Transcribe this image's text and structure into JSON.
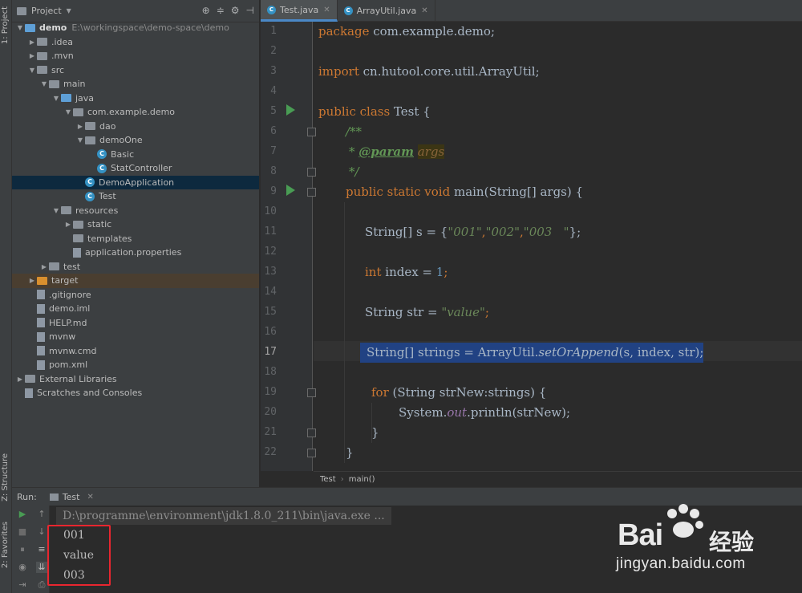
{
  "leftstrip": {
    "project_label": "1: Project",
    "structure_label": "Z: Structure",
    "favorites_label": "2: Favorites"
  },
  "project": {
    "header": "Project",
    "tree": [
      {
        "depth": 0,
        "arrow": "▼",
        "icon": "folder-blue",
        "label": "demo",
        "extra": "E:\\workingspace\\demo-space\\demo",
        "bold": true
      },
      {
        "depth": 1,
        "arrow": "▶",
        "icon": "folder",
        "label": ".idea"
      },
      {
        "depth": 1,
        "arrow": "▶",
        "icon": "folder",
        "label": ".mvn"
      },
      {
        "depth": 1,
        "arrow": "▼",
        "icon": "folder",
        "label": "src"
      },
      {
        "depth": 2,
        "arrow": "▼",
        "icon": "folder",
        "label": "main"
      },
      {
        "depth": 3,
        "arrow": "▼",
        "icon": "folder-blue",
        "label": "java"
      },
      {
        "depth": 4,
        "arrow": "▼",
        "icon": "folder",
        "label": "com.example.demo"
      },
      {
        "depth": 5,
        "arrow": "▶",
        "icon": "folder",
        "label": "dao"
      },
      {
        "depth": 5,
        "arrow": "▼",
        "icon": "folder",
        "label": "demoOne"
      },
      {
        "depth": 6,
        "arrow": "",
        "icon": "class",
        "label": "Basic"
      },
      {
        "depth": 6,
        "arrow": "",
        "icon": "class",
        "label": "StatController"
      },
      {
        "depth": 5,
        "arrow": "",
        "icon": "class",
        "label": "DemoApplication",
        "selected": true
      },
      {
        "depth": 5,
        "arrow": "",
        "icon": "class",
        "label": "Test"
      },
      {
        "depth": 3,
        "arrow": "▼",
        "icon": "folder",
        "label": "resources"
      },
      {
        "depth": 4,
        "arrow": "▶",
        "icon": "folder",
        "label": "static"
      },
      {
        "depth": 4,
        "arrow": "",
        "icon": "folder",
        "label": "templates"
      },
      {
        "depth": 4,
        "arrow": "",
        "icon": "file",
        "label": "application.properties"
      },
      {
        "depth": 2,
        "arrow": "▶",
        "icon": "folder",
        "label": "test"
      },
      {
        "depth": 1,
        "arrow": "▶",
        "icon": "folder-orange",
        "label": "target",
        "target": true
      },
      {
        "depth": 1,
        "arrow": "",
        "icon": "file",
        "label": ".gitignore"
      },
      {
        "depth": 1,
        "arrow": "",
        "icon": "file",
        "label": "demo.iml"
      },
      {
        "depth": 1,
        "arrow": "",
        "icon": "file",
        "label": "HELP.md"
      },
      {
        "depth": 1,
        "arrow": "",
        "icon": "file",
        "label": "mvnw"
      },
      {
        "depth": 1,
        "arrow": "",
        "icon": "file",
        "label": "mvnw.cmd"
      },
      {
        "depth": 1,
        "arrow": "",
        "icon": "file",
        "label": "pom.xml"
      },
      {
        "depth": 0,
        "arrow": "▶",
        "icon": "library",
        "label": "External Libraries"
      },
      {
        "depth": 0,
        "arrow": "",
        "icon": "scratch",
        "label": "Scratches and Consoles"
      }
    ]
  },
  "tabs": [
    {
      "label": "Test.java",
      "active": true
    },
    {
      "label": "ArrayUtil.java",
      "active": false
    }
  ],
  "editor": {
    "line_numbers": [
      "1",
      "2",
      "3",
      "4",
      "5",
      "6",
      "7",
      "8",
      "9",
      "10",
      "11",
      "12",
      "13",
      "14",
      "15",
      "16",
      "17",
      "18",
      "19",
      "20",
      "21",
      "22"
    ],
    "current_line": "17",
    "code": {
      "l1_kw": "package",
      "l1_rest": " com.example.demo;",
      "l3_kw": "import",
      "l3_rest": " cn.hutool.core.util.ArrayUtil;",
      "l5_kw": "public class",
      "l5_rest": " Test {",
      "l6": "/**",
      "l7_star": "* ",
      "l7_tag": "@param",
      "l7_param": "args",
      "l8": "*/",
      "l9_kw": "public static void",
      "l9_rest": " main(String[] args) {",
      "l11_a": "String[] s = {",
      "l11_s1": "\"001\"",
      "l11_c1": ",",
      "l11_s2": "\"002\"",
      "l11_c2": ",",
      "l11_s3": "\"003   \"",
      "l11_b": "};",
      "l13_kw": "int",
      "l13_a": " index = ",
      "l13_num": "1",
      "l13_b": ";",
      "l15_a": "String str = ",
      "l15_s": "\"value\"",
      "l15_b": ";",
      "l17_a": "String[] strings = ArrayUtil.",
      "l17_m": "setOrAppend",
      "l17_b": "(s, index, str);",
      "l19_kw": "for",
      "l19_rest": " (String strNew:strings) {",
      "l20_a": "System.",
      "l20_out": "out",
      "l20_b": ".println(strNew);",
      "l21": "}",
      "l22": "}"
    }
  },
  "breadcrumb": {
    "file": "Test",
    "method": "main()"
  },
  "run": {
    "label": "Run:",
    "tab": "Test",
    "command": "D:\\programme\\environment\\jdk1.8.0_211\\bin\\java.exe ...",
    "output": [
      "001",
      "value",
      "003"
    ]
  },
  "watermark": {
    "brand": "Bai",
    "brand2": "经验",
    "url": "jingyan.baidu.com"
  },
  "colors": {
    "highlight": "#214283",
    "run_green": "#499c54",
    "keyword": "#cc7832",
    "string": "#6a8759",
    "redbox": "#e8262f"
  }
}
